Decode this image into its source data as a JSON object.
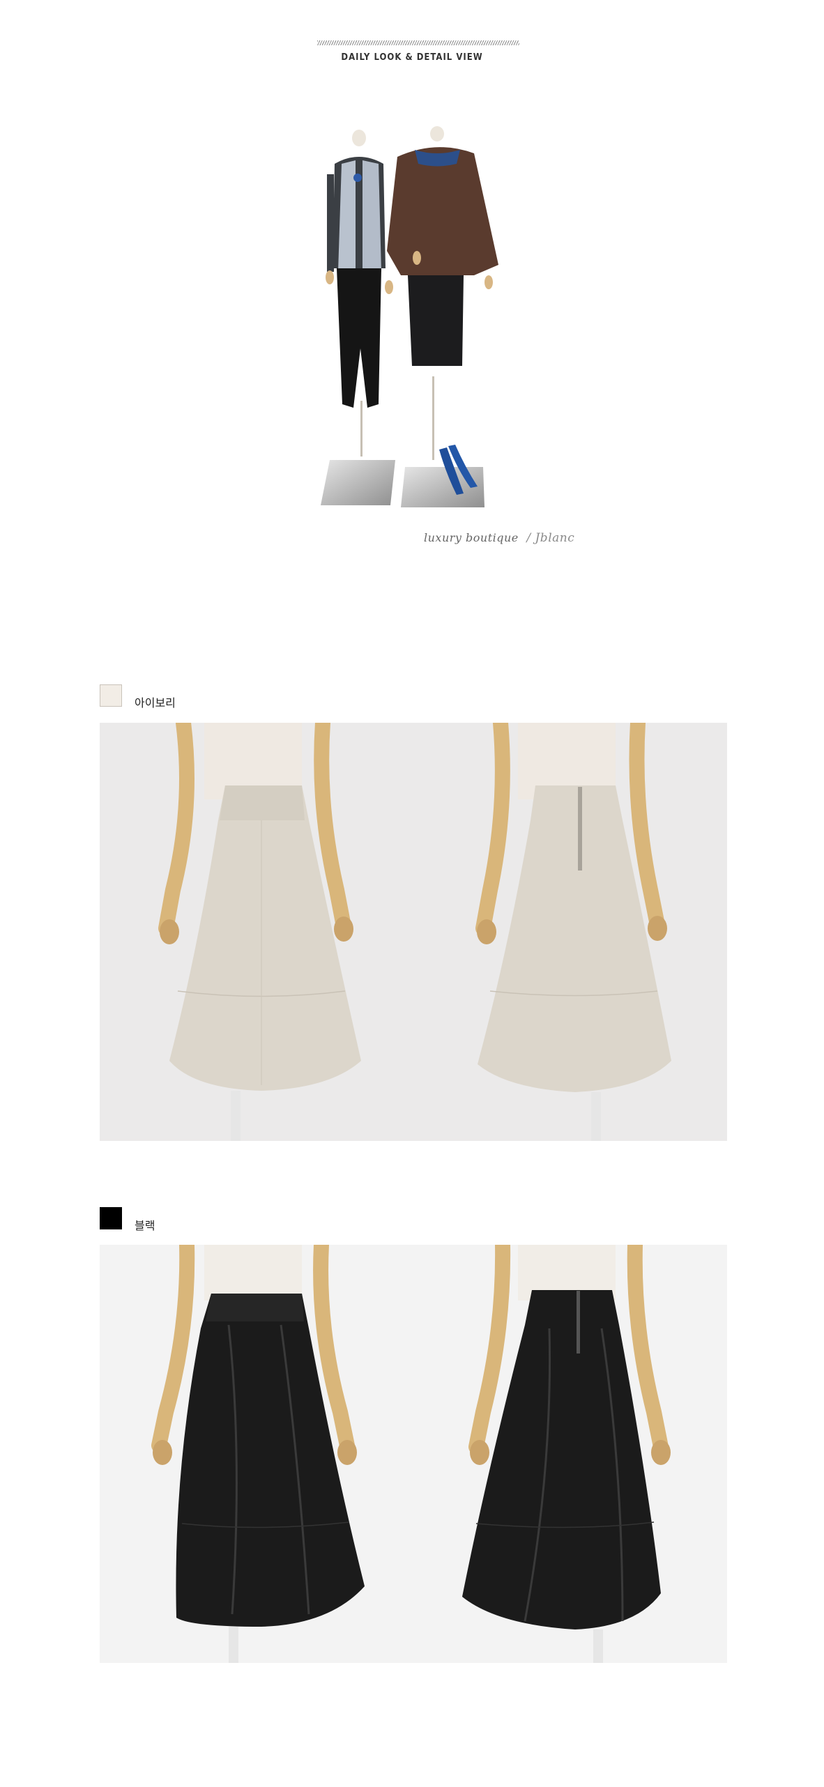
{
  "header": {
    "title": "DAILY LOOK & DETAIL VIEW"
  },
  "daily_look": {
    "caption_brand": "luxury boutique",
    "caption_signature": "/ Jblanc"
  },
  "colors": [
    {
      "label": "아이보리",
      "swatch": "#f2ede6",
      "skirt": "#dcd6cb",
      "skirt_shade": "#c9c2b6",
      "bg": "#e9e8e6"
    },
    {
      "label": "블랙",
      "swatch": "#000000",
      "skirt": "#1b1b1b",
      "skirt_shade": "#3a3a3a",
      "bg": "#f3f3f3"
    }
  ]
}
